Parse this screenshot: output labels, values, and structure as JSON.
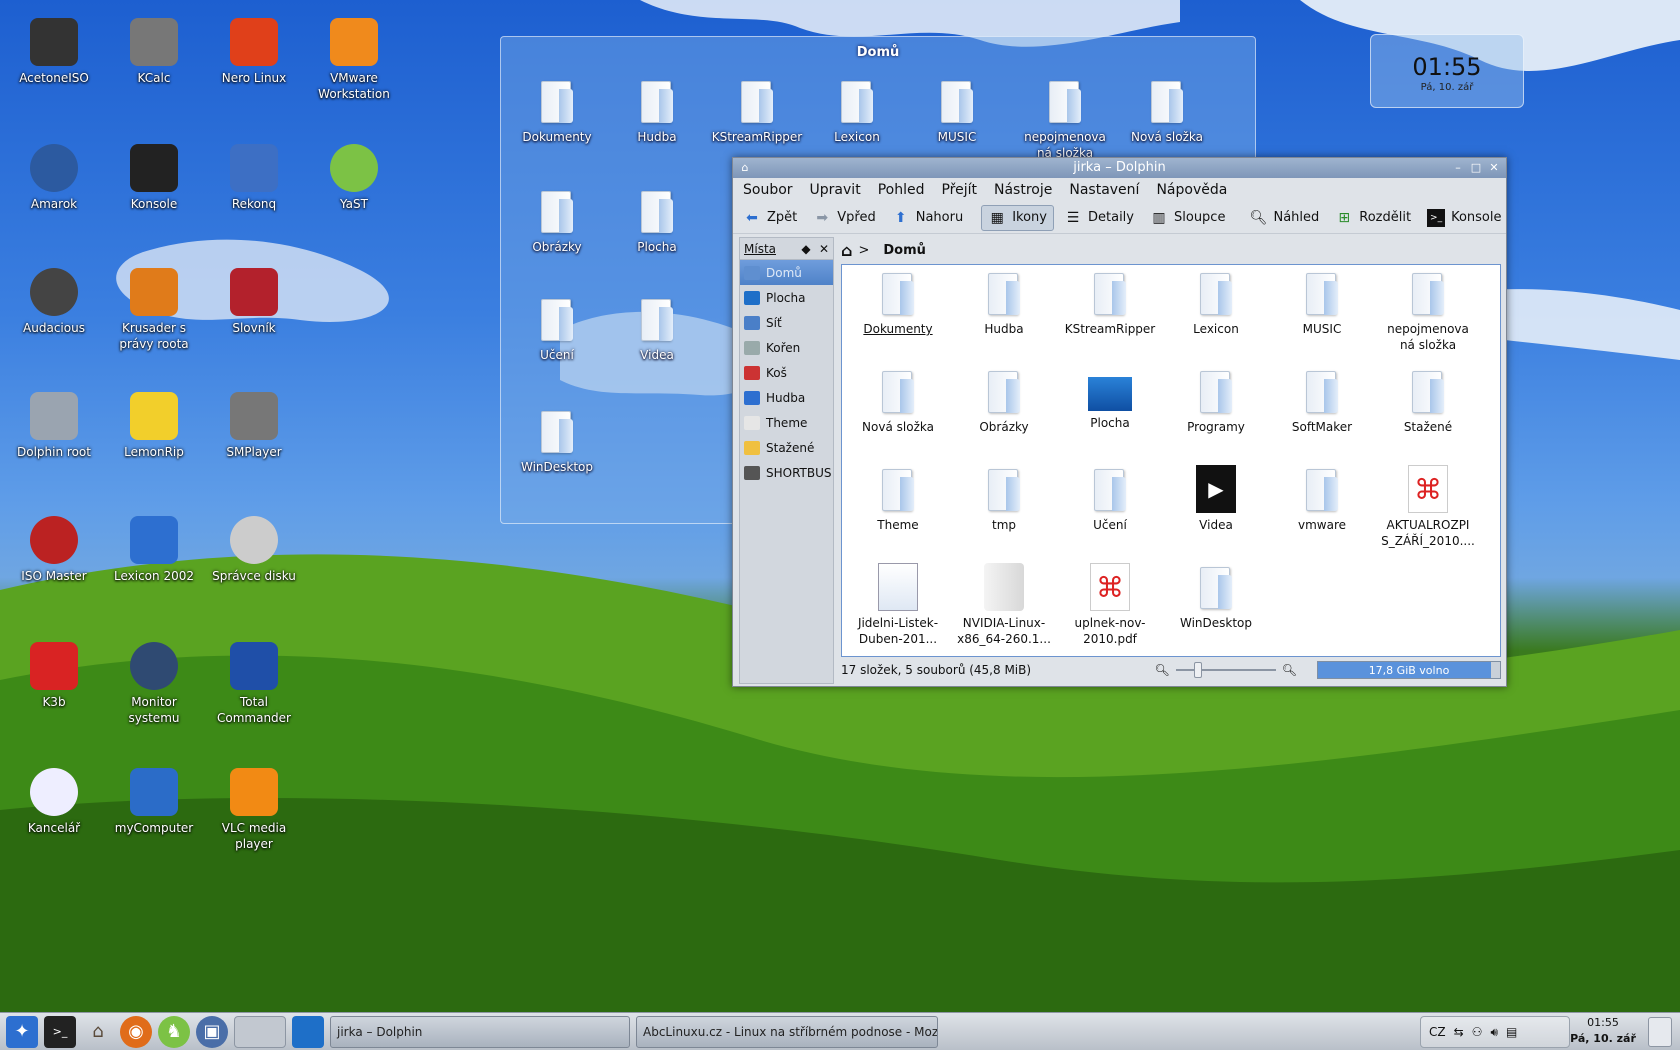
{
  "desktop_icons": [
    {
      "label": "AcetoneISO",
      "icon": "acetoneiso-icon"
    },
    {
      "label": "KCalc",
      "icon": "kcalc-icon"
    },
    {
      "label": "Nero Linux",
      "icon": "nero-icon"
    },
    {
      "label": "VMware Workstation",
      "icon": "vmware-icon"
    },
    {
      "label": "Amarok",
      "icon": "amarok-icon"
    },
    {
      "label": "Konsole",
      "icon": "konsole-icon"
    },
    {
      "label": "Rekonq",
      "icon": "rekonq-icon"
    },
    {
      "label": "YaST",
      "icon": "yast-icon"
    },
    {
      "label": "Audacious",
      "icon": "audacious-icon"
    },
    {
      "label": "Krusader s právy roota",
      "icon": "krusader-icon"
    },
    {
      "label": "Slovník",
      "icon": "dictionary-icon"
    },
    {
      "label": "Dolphin root",
      "icon": "laptop-icon"
    },
    {
      "label": "LemonRip",
      "icon": "lemonrip-icon"
    },
    {
      "label": "SMPlayer",
      "icon": "smplayer-icon"
    },
    {
      "label": "ISO Master",
      "icon": "isomaster-icon"
    },
    {
      "label": "Lexicon 2002",
      "icon": "lexicon-icon"
    },
    {
      "label": "Správce disku",
      "icon": "disk-manager-icon"
    },
    {
      "label": "K3b",
      "icon": "k3b-icon"
    },
    {
      "label": "Monitor systemu",
      "icon": "system-monitor-icon"
    },
    {
      "label": "Total Commander",
      "icon": "floppy-icon"
    },
    {
      "label": "Kancelář",
      "icon": "office-icon"
    },
    {
      "label": "myComputer",
      "icon": "computer-icon"
    },
    {
      "label": "VLC media player",
      "icon": "vlc-icon"
    }
  ],
  "folderview": {
    "title": "Domů",
    "items": [
      "Dokumenty",
      "Hudba",
      "KStreamRipper",
      "Lexicon",
      "MUSIC",
      "nepojmenova ná složka",
      "Nová složka",
      "Obrázky",
      "Plocha",
      "Učení",
      "Videa",
      "WinDesktop"
    ]
  },
  "clock_widget": {
    "time": "01:55",
    "date": "Pá, 10. zář"
  },
  "dolphin": {
    "title": "jirka – Dolphin",
    "menu": [
      "Soubor",
      "Upravit",
      "Pohled",
      "Přejít",
      "Nástroje",
      "Nastavení",
      "Nápověda"
    ],
    "toolbar": {
      "back": "Zpět",
      "forward": "Vpřed",
      "up": "Nahoru",
      "icons": "Ikony",
      "details": "Detaily",
      "columns": "Sloupce",
      "preview": "Náhled",
      "split": "Rozdělit",
      "konsole": "Konsole"
    },
    "places": {
      "title": "Místa",
      "items": [
        "Domů",
        "Plocha",
        "Síť",
        "Kořen",
        "Koš",
        "Hudba",
        "Theme",
        "Stažené",
        "SHORTBUS"
      ]
    },
    "breadcrumb": "Domů",
    "files": [
      "Dokumenty",
      "Hudba",
      "KStreamRipper",
      "Lexicon",
      "MUSIC",
      "nepojmenova ná složka",
      "Nová složka",
      "Obrázky",
      "Plocha",
      "Programy",
      "SoftMaker",
      "Stažené",
      "Theme",
      "tmp",
      "Učení",
      "Videa",
      "vmware",
      "AKTUALROZPI S_ZÁŘÍ_2010....",
      "Jidelni-Listek-Duben-201...",
      "NVIDIA-Linux-x86_64-260.1...",
      "uplnek-nov-2010.pdf",
      "WinDesktop"
    ],
    "status": "17 složek, 5 souborů (45,8 MiB)",
    "free_space": "17,8 GiB volno",
    "free_fraction": 0.95
  },
  "taskbar": {
    "tasks": [
      "jirka – Dolphin",
      "AbcLinuxu.cz - Linux na stříbrném podnose - Moz"
    ],
    "keyboard": "CZ",
    "time": "01:55",
    "date": "Pá, 10. zář"
  },
  "colors": {
    "accent": "#4f82c8",
    "sky": "#2f6fd8",
    "grass": "#3a7a1e"
  }
}
